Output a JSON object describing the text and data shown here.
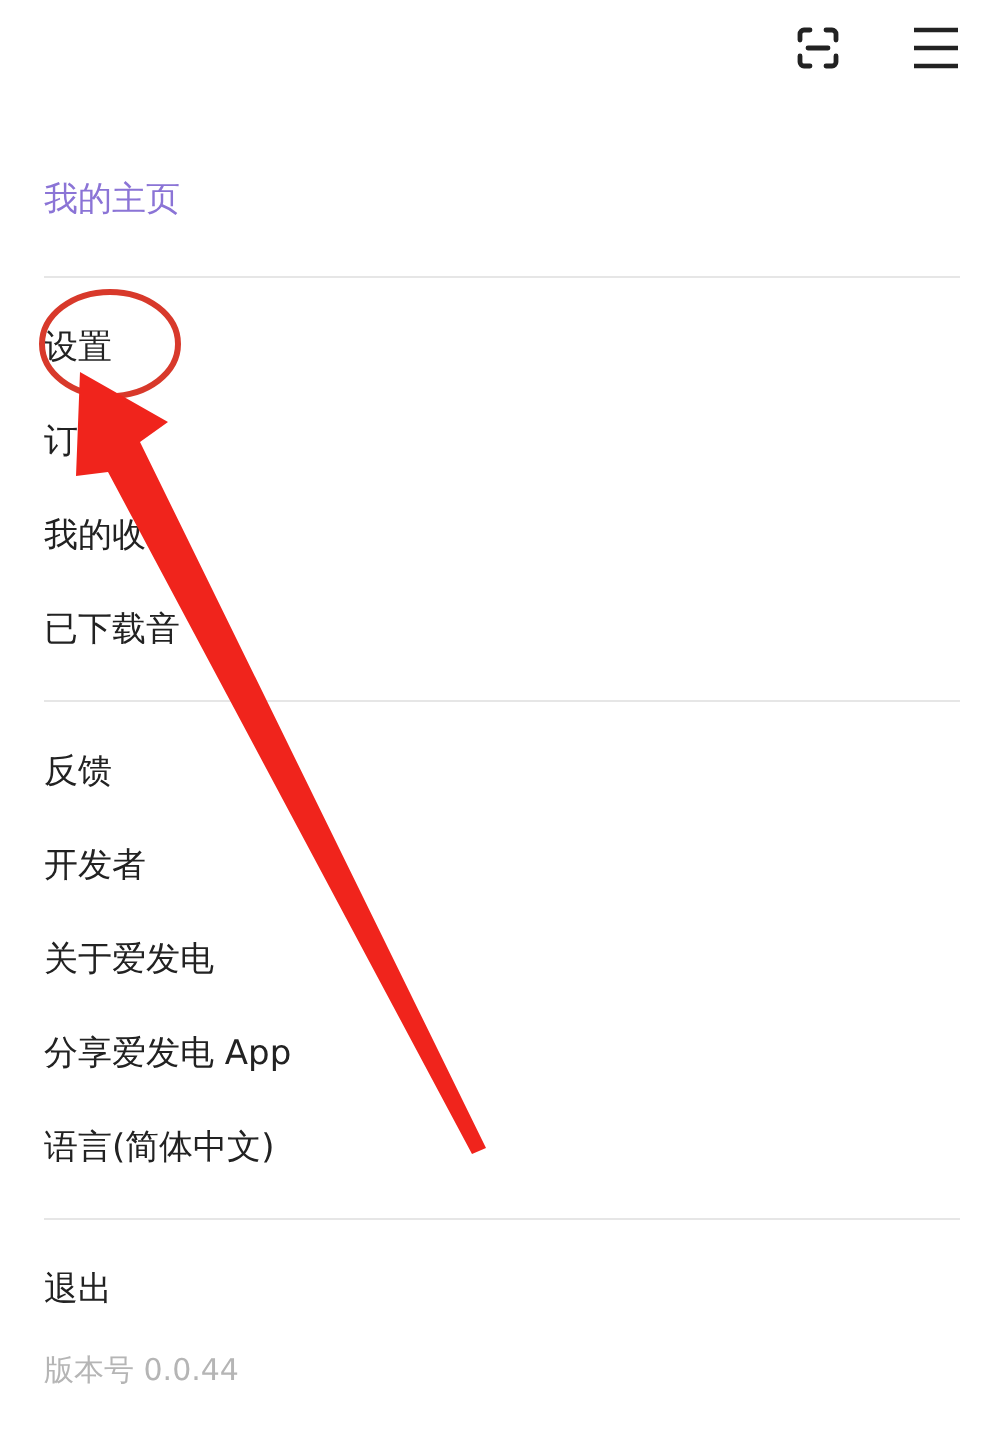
{
  "toolbar": {
    "icons": [
      {
        "kind": "scan"
      },
      {
        "kind": "menu"
      }
    ]
  },
  "profile_link": "我的主页",
  "sections": [
    {
      "items": [
        "设置",
        "订",
        "我的收",
        "已下载音"
      ]
    },
    {
      "items": [
        "反馈",
        "开发者",
        "关于爱发电",
        "分享爱发电 App",
        "语言(简体中文)"
      ]
    },
    {
      "items": [
        "退出"
      ]
    }
  ],
  "version": "版本号 0.0.44"
}
